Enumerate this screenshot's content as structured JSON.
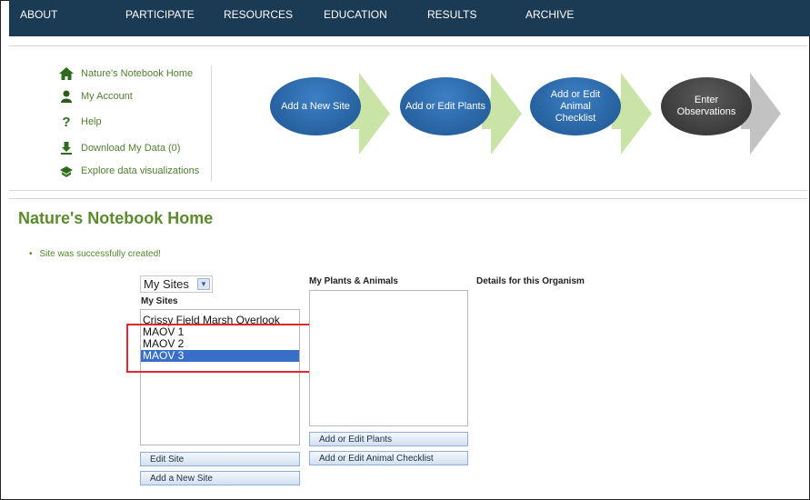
{
  "nav": {
    "items": [
      "ABOUT",
      "PARTICIPATE",
      "RESOURCES",
      "EDUCATION",
      "RESULTS",
      "ARCHIVE"
    ]
  },
  "quicklinks": [
    {
      "label": "Nature's Notebook Home",
      "icon": "home-icon"
    },
    {
      "label": "My Account",
      "icon": "user-icon"
    },
    {
      "label": "Help",
      "icon": "help-icon"
    },
    {
      "label": "Download My Data (0)",
      "icon": "download-icon"
    },
    {
      "label": "Explore data visualizations",
      "icon": "chart-icon"
    }
  ],
  "steps": [
    {
      "label": "Add a New Site"
    },
    {
      "label": "Add or Edit Plants"
    },
    {
      "label": "Add or Edit Animal Checklist"
    },
    {
      "label": "Enter Observations"
    }
  ],
  "main": {
    "title": "Nature's Notebook Home",
    "success_message": "Site was successfully created!",
    "bullet": "•",
    "sites_dropdown": "My Sites",
    "sites_label": "My Sites",
    "sites": [
      "Crissy Field Marsh Overlook",
      "MAOV 1",
      "MAOV 2",
      "MAOV 3"
    ],
    "selected_site": "MAOV 3",
    "plants_label": "My Plants & Animals",
    "details_label": "Details for this Organism",
    "buttons": {
      "edit_site": "Edit Site",
      "add_site": "Add a New Site",
      "edit_plants": "Add or Edit Plants",
      "edit_animals": "Add or Edit Animal Checklist"
    }
  },
  "colors": {
    "nav_bg": "#1b3a54",
    "title_green": "#5c8a2e",
    "step_blue": "#2a64a6",
    "arrow_green": "#c9e4a6",
    "arrow_grey": "#c2c2c2",
    "selection_blue": "#3a6fc9",
    "highlight_red": "#e0292e"
  }
}
